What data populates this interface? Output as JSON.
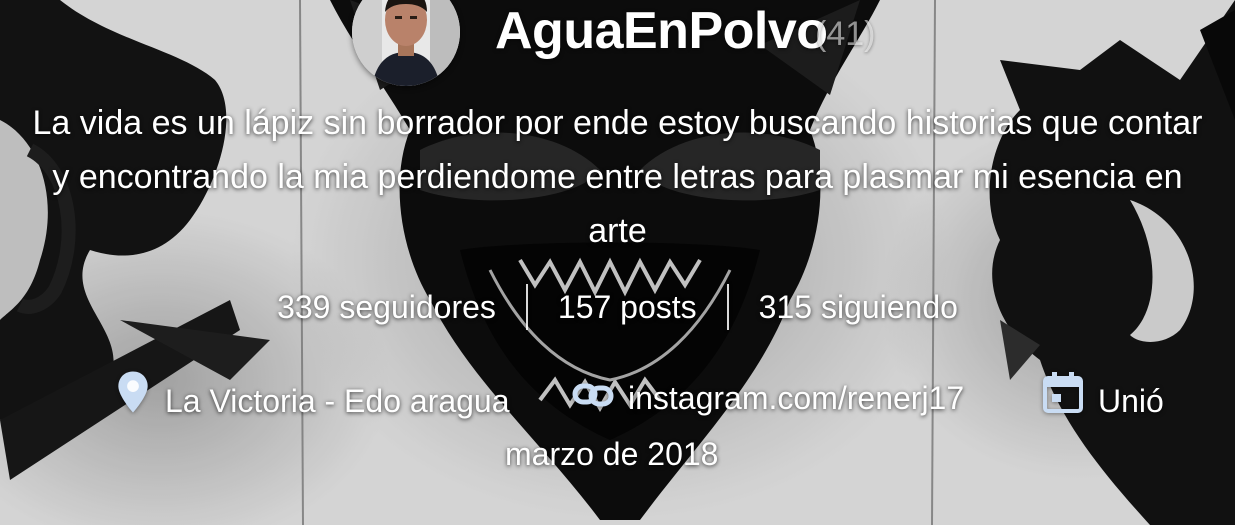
{
  "profile": {
    "username": "AguaEnPolvo",
    "count": "(41)",
    "bio": "La vida es un lápiz sin borrador por ende estoy buscando historias que contar y encontrando la mia perdiendome entre letras para plasmar mi esencia en arte"
  },
  "stats": {
    "followers": "339 seguidores",
    "posts": "157 posts",
    "following": "315 siguiendo"
  },
  "meta": {
    "location": "La Victoria - Edo aragua",
    "website": "instagram.com/renerj17",
    "joined_prefix": "Unió",
    "joined_date": "marzo de 2018"
  },
  "icons": {
    "location": "map-pin-icon",
    "link": "link-icon",
    "calendar": "calendar-icon"
  },
  "colors": {
    "icon_tint": "#c9dcf3",
    "text": "#ffffff"
  }
}
